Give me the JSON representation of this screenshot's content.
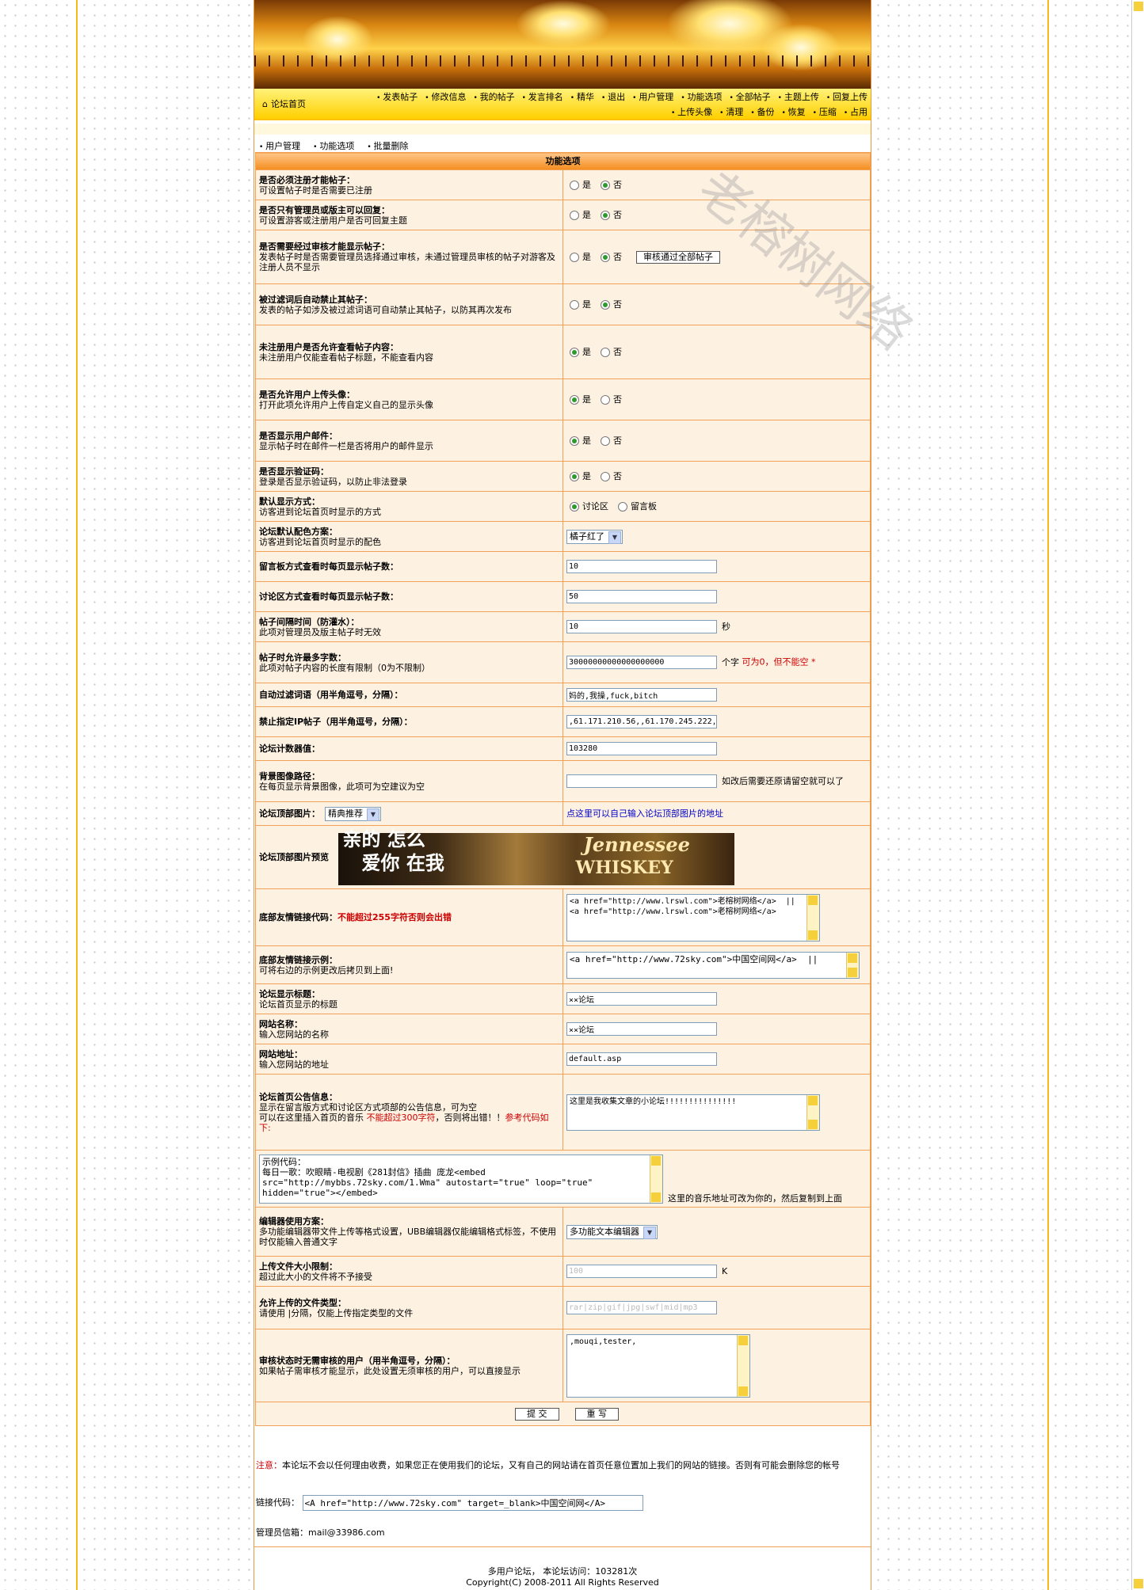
{
  "nav": {
    "home": "论坛首页",
    "row1": [
      "发表帖子",
      "修改信息",
      "我的帖子",
      "发言排名",
      "精华",
      "退出",
      "用户管理",
      "功能选项",
      "全部帖子",
      "主题上传",
      "回复上传"
    ],
    "row2": [
      "上传头像",
      "清理",
      "备份",
      "恢复",
      "压缩",
      "占用"
    ]
  },
  "subnav": [
    "用户管理",
    "功能选项",
    "批量删除"
  ],
  "section_title": "功能选项",
  "watermark": "老榕树网络",
  "rows": {
    "r1": {
      "title": "是否必须注册才能帖子：",
      "desc": "可设置帖子时是否需要已注册"
    },
    "r2": {
      "title": "是否只有管理员或版主可以回复：",
      "desc": "可设置游客或注册用户是否可回复主题"
    },
    "r3": {
      "title": "是否需要经过审核才能显示帖子：",
      "desc": "发表帖子时是否需要管理员选择通过审核，未通过管理员审核的帖子对游客及注册人员不显示",
      "button": "审核通过全部帖子"
    },
    "r4": {
      "title": "被过滤词后自动禁止其帖子：",
      "desc": "发表的帖子如涉及被过滤词语可自动禁止其帖子，以防其再次发布"
    },
    "r5": {
      "title": "未注册用户是否允许查看帖子内容：",
      "desc": "未注册用户仅能查看帖子标题，不能查看内容"
    },
    "r6": {
      "title": "是否允许用户上传头像：",
      "desc": "打开此项允许用户上传自定义自己的显示头像"
    },
    "r7": {
      "title": "是否显示用户邮件：",
      "desc": "显示帖子时在邮件一栏是否将用户的邮件显示"
    },
    "r8": {
      "title": "是否显示验证码：",
      "desc": "登录是否显示验证码，以防止非法登录"
    },
    "r9": {
      "title": "默认显示方式：",
      "desc": "访客进到论坛首页时显示的方式",
      "opt1": "讨论区",
      "opt2": "留言板"
    },
    "r10": {
      "title": "论坛默认配色方案：",
      "desc": "访客进到论坛首页时显示的配色",
      "value": "橘子红了"
    },
    "r11": {
      "title": "留言板方式查看时每页显示帖子数：",
      "value": "10"
    },
    "r12": {
      "title": "讨论区方式查看时每页显示帖子数：",
      "value": "50"
    },
    "r13": {
      "title": "帖子间隔时间（防灌水）：",
      "desc": "此项对管理员及版主帖子时无效",
      "value": "10",
      "unit": "秒"
    },
    "r14": {
      "title": "帖子时允许最多字数：",
      "desc": "此项对帖子内容的长度有限制（0为不限制）",
      "value": "30000000000000000000",
      "unit": "个字",
      "note": "可为0，但不能空 *"
    },
    "r15": {
      "title": "自动过滤词语（用半角逗号，分隔）：",
      "value": "妈的,我操,fuck,bitch"
    },
    "r16": {
      "title": "禁止指定IP帖子（用半角逗号，分隔）：",
      "value": ",61.171.210.56,,61.170.245.222,("
    },
    "r17": {
      "title": "论坛计数器值：",
      "value": "103280"
    },
    "r18": {
      "title": "背景图像路径：",
      "desc": "在每页显示背景图像，此项可为空建议为空",
      "value": "",
      "note": "如改后需要还原请留空就可以了"
    },
    "r19": {
      "title": "论坛顶部图片：",
      "value": "精典推荐",
      "link": "点这里可以自己输入论坛顶部图片的地址"
    },
    "r20": {
      "title": "论坛顶部图片预览",
      "logo_l1": "亲的 怎么",
      "logo_l2": "爱你 在我",
      "logo_brand1": "Jennessee",
      "logo_brand2": "WHISKEY"
    },
    "r21": {
      "title": "底部友情链接代码：",
      "warn": "不能超过255字符否则会出错",
      "value": "<a href=\"http://www.lrswl.com\">老榕树网络</a>  ||<a href=\"http://www.lrswl.com\">老榕树网络</a>"
    },
    "r22": {
      "title": "底部友情链接示例：",
      "desc": "可将右边的示例更改后拷贝到上面!",
      "value": "<a href=\"http://www.72sky.com\">中国空间网</a>  ||"
    },
    "r23": {
      "title": "论坛显示标题：",
      "desc": "论坛首页显示的标题",
      "value": "××论坛"
    },
    "r24": {
      "title": "网站名称：",
      "desc": "输入您网站的名称",
      "value": "××论坛"
    },
    "r25": {
      "title": "网站地址：",
      "desc": "输入您网站的地址",
      "value": "default.asp"
    },
    "r26": {
      "title": "论坛首页公告信息：",
      "desc1": "显示在留言版方式和讨论区方式项部的公告信息，可为空",
      "desc2": "可以在这里插入首页的音乐",
      "warn": "不能超过300字符",
      "desc3": "，否则将出错！！",
      "ref": "参考代码如下:",
      "value": "这里是我收集文章的小论坛!!!!!!!!!!!!!!!"
    },
    "r27": {
      "value": "示例代码：\n每日一歌：吹眼睛-电视剧《281封信》插曲 庞龙<embed src=\"http://mybbs.72sky.com/1.Wma\" autostart=\"true\" loop=\"true\" hidden=\"true\"></embed>",
      "note": "这里的音乐地址可改为你的，然后复制到上面"
    },
    "r28": {
      "title": "编辑器使用方案：",
      "desc": "多功能编辑器带文件上传等格式设置，UBB编辑器仅能编辑格式标签，不使用时仅能输入普通文字",
      "value": "多功能文本编辑器"
    },
    "r29": {
      "title": "上传文件大小限制：",
      "desc": "超过此大小的文件将不予接受",
      "value": "100",
      "unit": "K"
    },
    "r30": {
      "title": "允许上传的文件类型：",
      "desc": "请使用 |分隔，仅能上传指定类型的文件",
      "value": "rar|zip|gif|jpg|swf|mid|mp3"
    },
    "r31": {
      "title": "审核状态时无需审核的用户（用半角逗号，分隔）：",
      "desc": "如果帖子需审核才能显示，此处设置无须审核的用户，可以直接显示",
      "value": ",mouqi,tester,"
    }
  },
  "yes": "是",
  "no": "否",
  "submit": "提 交",
  "reset": "重 写",
  "notice_label": "注意：",
  "notice": "本论坛不会以任何理由收费，如果您正在使用我们的论坛，又有自己的网站请在首页任意位置加上我们的网站的链接。否则有可能会删除您的帐号",
  "link_label": "链接代码：",
  "link_code": "<A href=\"http://www.72sky.com\" target=_blank>中国空间网</A>",
  "mail": "管理员信箱：mail@33986.com",
  "footer1": "多用户论坛，  本论坛访问：103281次",
  "footer2": "Copyright(C) 2008-2011 All Rights Reserved"
}
